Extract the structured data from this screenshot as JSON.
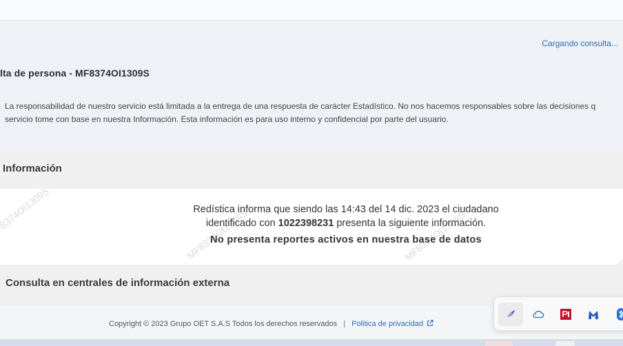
{
  "header": {
    "loading_text": "Cargando consulta...",
    "page_title": "lta de persona - MF8374OI1309S"
  },
  "disclaimer": {
    "line1": "La responsabilidad de nuestro servicio está limitada a la entrega de una respuesta de carácter Estadístico. No nos hacemos responsables sobre las decisiones q",
    "line2": "servicio tome con base en nuestra Información. Esta información es para uso interno y confidencial por parte del usuario."
  },
  "info_section": {
    "title": "Información"
  },
  "result": {
    "line1": "Redística informa que siendo las 14:43 del 14 dic. 2023 el ciudadano",
    "line2_prefix": "identificado con ",
    "id_number": "1022398231",
    "line2_suffix": " presenta la siguiente información.",
    "line3": "No presenta reportes activos en nuestra base de datos",
    "watermark": "MF8374OI1309S"
  },
  "external_section": {
    "title": "Consulta en centrales de información externa"
  },
  "footer": {
    "copyright": "Copyright © 2023 Grupo OET S.A.S Todos los derechos reservados",
    "separator": "|",
    "privacy_link": "Politica de privacidad"
  },
  "tray": {
    "icons": [
      "feather-icon",
      "cloud-icon",
      "pdf-reader-icon",
      "malwarebytes-icon",
      "bluetooth-icon"
    ],
    "colors": {
      "feather": "#8a4fc9",
      "cloud": "#2d6bb5",
      "pdf": "#c8102e",
      "malwarebytes": "#1a56c4",
      "bluetooth": "#1f6fd6"
    }
  }
}
